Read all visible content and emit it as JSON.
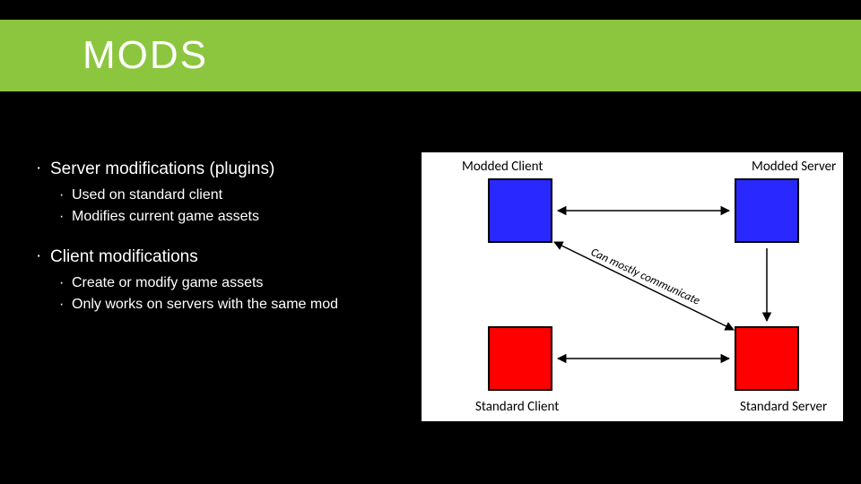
{
  "title": "MODS",
  "bullets": {
    "b1": "Server modifications (plugins)",
    "b1s1": "Used on standard client",
    "b1s2": "Modifies current game assets",
    "b2": "Client modifications",
    "b2s1": "Create or modify game assets",
    "b2s2": "Only works on servers with the same mod"
  },
  "diagram": {
    "labels": {
      "tl": "Modded Client",
      "tr": "Modded Server",
      "bl": "Standard Client",
      "br": "Standard Server",
      "mid": "Can mostly communicate"
    },
    "colors": {
      "modded": "#2929ff",
      "standard": "#ff0000",
      "stroke": "#000"
    }
  }
}
